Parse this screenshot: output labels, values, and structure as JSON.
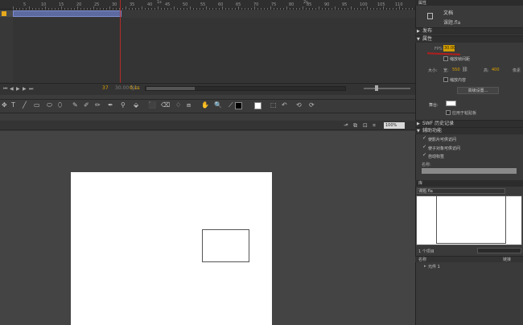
{
  "timeline": {
    "ruler_ticks": [
      "5",
      "10",
      "15",
      "20",
      "25",
      "30",
      "35",
      "40",
      "45",
      "50",
      "55",
      "60",
      "65",
      "70",
      "75",
      "80",
      "85",
      "90",
      "95",
      "100",
      "105",
      "110"
    ],
    "ruler_seconds": [
      "1s",
      "2s"
    ],
    "current_frame": "37",
    "fps": "30.00 fps",
    "time": "0.1s",
    "controls": [
      "⏮",
      "◀",
      "▶",
      "▶",
      "⏭"
    ]
  },
  "tools": {
    "icons": [
      "✥",
      "T",
      "╱",
      "▭",
      "⬭",
      "⬯",
      "✎",
      "✐",
      "✏",
      "✒",
      "⚲",
      "⬙",
      "⬛",
      "⌫",
      "♢",
      "⧈",
      "✋",
      "🔍",
      "⟋",
      "⬚",
      "↶",
      "⟲",
      "⟳"
    ]
  },
  "stage": {
    "zoom": "100%",
    "editbar_icons": [
      "⬏",
      "⧉",
      "⊡",
      "⌗"
    ]
  },
  "panel": {
    "tab": "属性",
    "doc_type": "文档",
    "doc_name": "课题.fla",
    "sections": {
      "publish": "发布",
      "properties": "属性",
      "swf_history": "SWF 历史记录",
      "accessibility": "辅助功能"
    },
    "fps_label": "FPS:",
    "fps_value": "30.00",
    "scale_spans": "缩放帧间距",
    "size_label": "大小:",
    "width_label": "宽:",
    "width_value": "550",
    "height_label": "高:",
    "height_value": "400",
    "unit_label": "像素",
    "scale_content": "缩放内容",
    "advanced_button": "高级设置...",
    "stage_label": "舞台:",
    "stage_color": "#ffffff",
    "apply_to_pasteboard": "应用于粘贴板",
    "access_options": [
      "使影片可供访问",
      "使子对象可供访问",
      "自动标签"
    ],
    "name_label": "名称:"
  },
  "library": {
    "tab": "库",
    "document": "课题.fla",
    "item_count": "1 个项目",
    "col_name": "名称",
    "col_link": "链接",
    "row": "元件 1"
  }
}
